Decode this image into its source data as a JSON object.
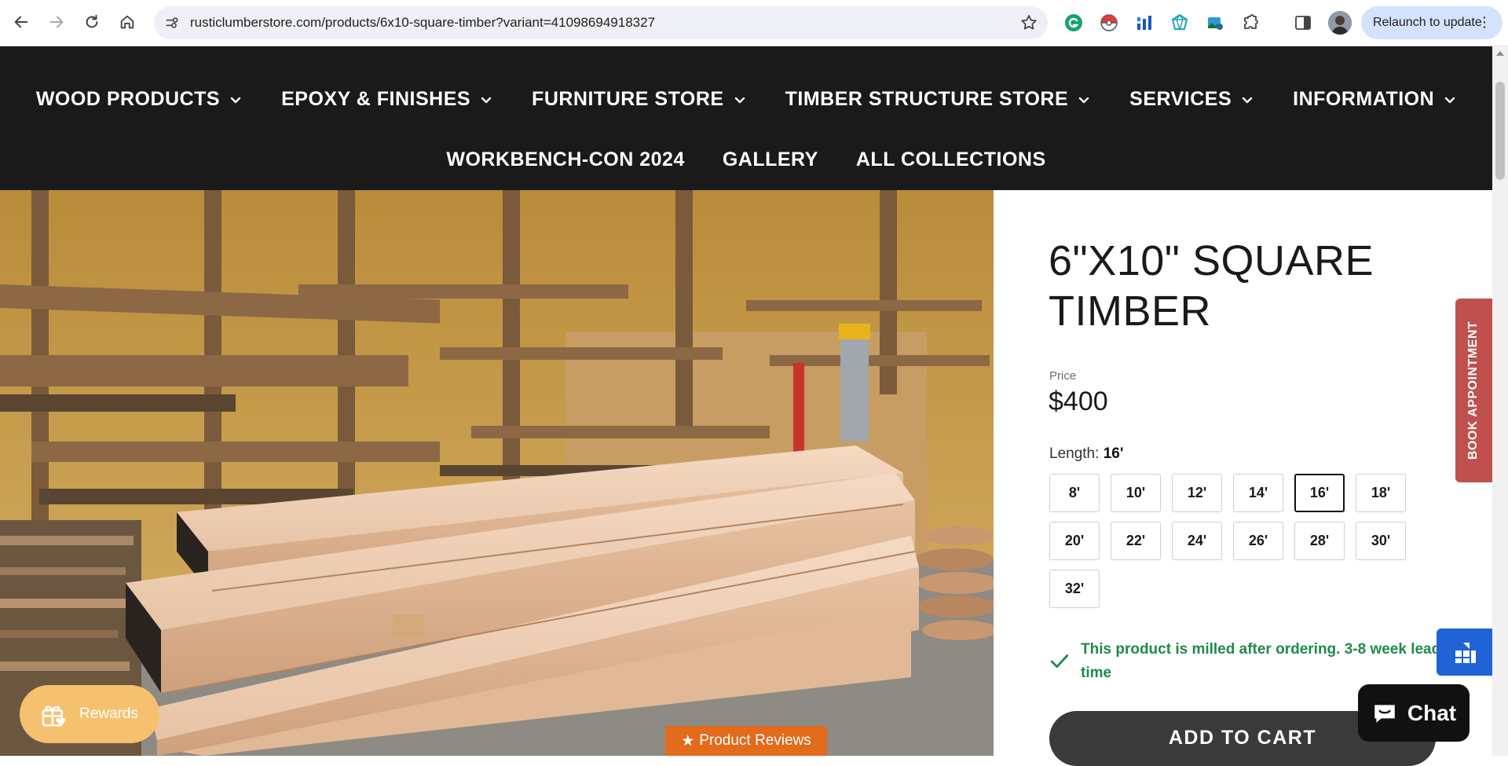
{
  "browser": {
    "url": "rusticlumberstore.com/products/6x10-square-timber?variant=41098694918327",
    "relaunch_label": "Relaunch to update",
    "icons": [
      "back-icon",
      "forward-icon",
      "reload-icon",
      "home-icon",
      "site-info-icon",
      "bookmark-star-icon",
      "grammarly-icon",
      "pokeball-icon",
      "chart-extension-icon",
      "gem-extension-icon",
      "photo-extension-icon",
      "extensions-puzzle-icon",
      "side-panel-icon",
      "profile-avatar"
    ]
  },
  "nav": {
    "row1": [
      {
        "label": "WOOD PRODUCTS"
      },
      {
        "label": "EPOXY & FINISHES"
      },
      {
        "label": "FURNITURE STORE"
      },
      {
        "label": "TIMBER STRUCTURE STORE"
      },
      {
        "label": "SERVICES"
      },
      {
        "label": "INFORMATION"
      }
    ],
    "row2": [
      {
        "label": "WORKBENCH-CON 2024"
      },
      {
        "label": "GALLERY"
      },
      {
        "label": "ALL COLLECTIONS"
      }
    ]
  },
  "product": {
    "title": "6\"X10\" SQUARE TIMBER",
    "price_label": "Price",
    "price": "$400",
    "length_label": "Length:",
    "selected_length": "16'",
    "lengths": [
      "8'",
      "10'",
      "12'",
      "14'",
      "16'",
      "18'",
      "20'",
      "22'",
      "24'",
      "26'",
      "28'",
      "30'",
      "32'"
    ],
    "lead_time": "This product is milled after ordering. 3-8 week lead time",
    "add_to_cart": "ADD TO CART"
  },
  "widgets": {
    "book_appointment": "BOOK APPOINTMENT",
    "chat": "Chat",
    "rewards": "Rewards",
    "reviews": "Product Reviews",
    "reviews_star": "★"
  },
  "colors": {
    "nav_bg": "#1a1a1a",
    "accent_green": "#1e8a4b",
    "book_red": "#c0504d",
    "reviews_orange": "#e26b1c",
    "rewards_yellow": "#f6c16f",
    "widget_blue": "#1f63d6"
  }
}
